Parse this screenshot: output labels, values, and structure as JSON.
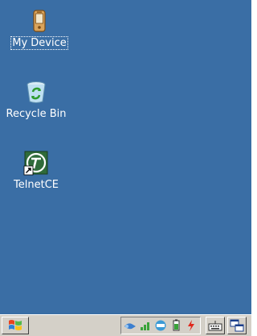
{
  "desktop": {
    "background": "#3a6ea5",
    "icons": [
      {
        "label": "My Device",
        "icon": "my-device-icon",
        "selected": true
      },
      {
        "label": "Recycle Bin",
        "icon": "recycle-bin-icon"
      },
      {
        "label": "TelnetCE",
        "icon": "telnetce-icon",
        "shortcut": true
      }
    ]
  },
  "taskbar": {
    "start_icon": "windows-flag-icon",
    "tray_icons": [
      "network-icon",
      "signal-icon",
      "connectivity-icon",
      "battery-icon",
      "power-icon"
    ],
    "buttons": [
      "keyboard-icon",
      "switch-windows-icon"
    ]
  }
}
